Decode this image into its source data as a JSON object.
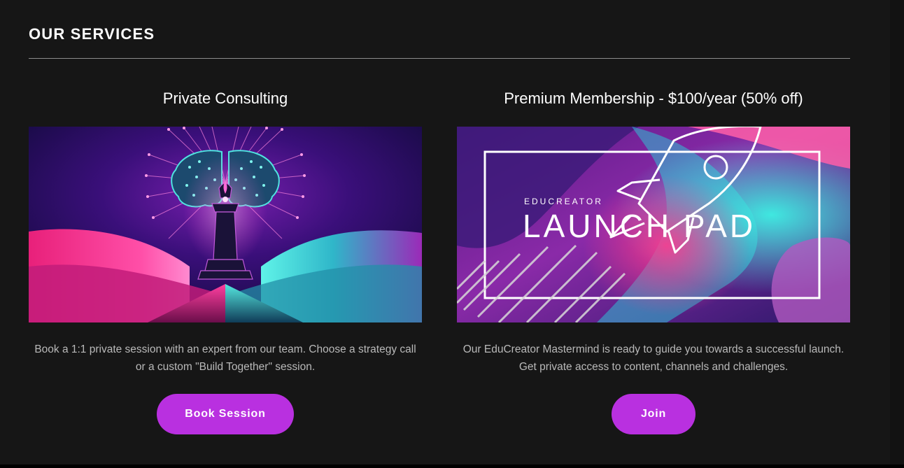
{
  "section": {
    "title": "OUR SERVICES"
  },
  "services": [
    {
      "title": "Private Consulting",
      "image_icon": "brain-chess-king-illustration",
      "description": "Book a 1:1 private session with an expert from our team. Choose a strategy call or a custom \"Build Together\" session.",
      "button_label": "Book Session"
    },
    {
      "title": "Premium Membership - $100/year (50% off)",
      "image_icon": "launch-pad-rocket-banner",
      "image_text_small": "EDUCREATOR",
      "image_text_large": "LAUNCH PAD",
      "description": "Our EduCreator Mastermind is ready to guide you towards a successful launch. Get private access to content, channels and challenges.",
      "button_label": "Join"
    }
  ],
  "colors": {
    "background": "#161616",
    "accent_button": "#b930e0",
    "title_text": "#ffffff",
    "body_text": "#b9b9b9",
    "divider": "#8c8c8c"
  }
}
